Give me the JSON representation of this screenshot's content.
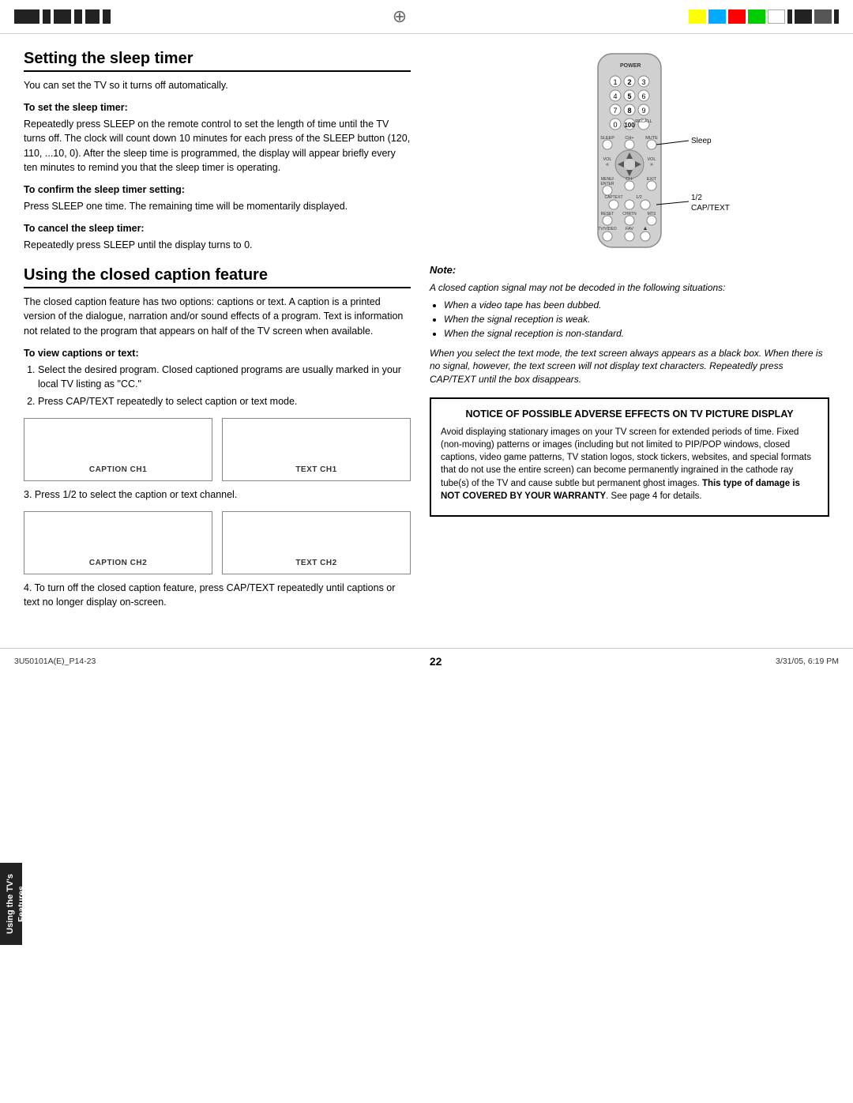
{
  "topBar": {
    "colors": [
      "#ffff00",
      "#00aaff",
      "#ff0000",
      "#00cc00",
      "#ffffff",
      "#000000"
    ]
  },
  "leftCol": {
    "section1": {
      "title": "Setting the sleep timer",
      "intro": "You can set the TV so it turns off automatically.",
      "steps": [
        {
          "label": "To set the sleep timer:",
          "text": "Repeatedly press SLEEP on the remote control to set the length of time until the TV turns off. The clock will count down 10 minutes for each press of the SLEEP button (120, 110, ...10, 0). After the sleep time is programmed, the display will appear briefly every ten minutes to remind you that the sleep timer is operating."
        },
        {
          "label": "To confirm the sleep timer setting:",
          "text": "Press SLEEP one time. The remaining time will be momentarily displayed."
        },
        {
          "label": "To cancel the sleep timer:",
          "text": "Repeatedly press SLEEP until the display turns to 0."
        }
      ]
    },
    "section2": {
      "title": "Using the closed caption feature",
      "intro": "The closed caption feature has two options: captions or text. A caption is a printed version of the dialogue, narration and/or sound effects of a program. Text is information not related to the program that appears on half of the TV screen when available.",
      "viewLabel": "To view captions or text:",
      "viewSteps": [
        "Select the desired program. Closed captioned programs are usually marked in your local TV listing as \"CC.\"",
        "Press CAP/TEXT repeatedly to select caption or text mode."
      ],
      "captionRow1": [
        {
          "label": "CAPTION CH1"
        },
        {
          "label": "TEXT CH1"
        }
      ],
      "step3": "Press 1/2 to select the caption or text channel.",
      "captionRow2": [
        {
          "label": "CAPTION CH2"
        },
        {
          "label": "TEXT CH2"
        }
      ],
      "step4": "To turn off the closed caption feature, press CAP/TEXT repeatedly until captions or text no longer display on-screen."
    }
  },
  "rightCol": {
    "sleepLabel": "Sleep",
    "capTextLabel": "1/2\nCAP/TEXT",
    "note": {
      "title": "Note:",
      "intro": "A closed caption signal may not be decoded in the following situations:",
      "bullets": [
        "When a video tape has been dubbed.",
        "When the signal reception is weak.",
        "When the signal reception is non-standard."
      ],
      "after": "When you select the text mode, the text screen always appears as a black box. When there is no signal, however, the text screen will not display text characters. Repeatedly press CAP/TEXT until the box disappears."
    },
    "notice": {
      "title": "NOTICE OF POSSIBLE ADVERSE EFFECTS ON TV PICTURE DISPLAY",
      "text": "Avoid displaying stationary images on your TV screen for extended periods of time. Fixed (non-moving) patterns or images (including but not limited to PIP/POP windows, closed captions, video game patterns, TV station logos, stock tickers, websites, and special formats that do not use the entire screen) can become permanently ingrained in the cathode ray tube(s) of the TV and cause subtle but permanent ghost images.",
      "boldText": "This type of damage is NOT COVERED BY YOUR WARRANTY",
      "afterBold": ". See page 4 for details."
    }
  },
  "sideTab": {
    "line1": "Using the TV's",
    "line2": "Features"
  },
  "footer": {
    "left": "3U50101A(E)_P14-23",
    "center": "22",
    "right": "3/31/05, 6:19 PM"
  }
}
